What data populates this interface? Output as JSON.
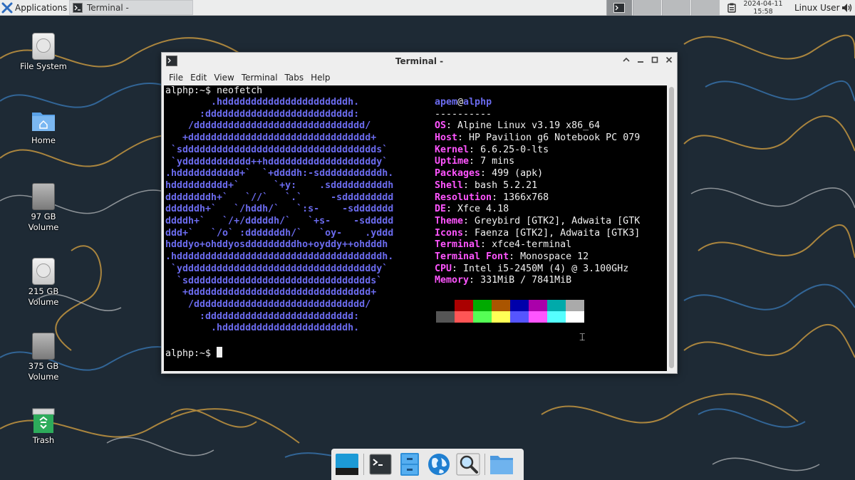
{
  "top_panel": {
    "applications_label": "Applications",
    "taskbar_item_label": "Terminal -",
    "clock_date": "2024-04-11",
    "clock_time": "15:58",
    "user_label": "Linux User"
  },
  "desktop_icons": [
    {
      "label": "File System",
      "icon": "drive-icon"
    },
    {
      "label": "Home",
      "icon": "home-folder-icon"
    },
    {
      "label": "97 GB Volume",
      "icon": "volume-icon"
    },
    {
      "label": "215 GB Volume",
      "icon": "drive-icon"
    },
    {
      "label": "375 GB Volume",
      "icon": "volume-icon"
    },
    {
      "label": "Trash",
      "icon": "trash-icon"
    }
  ],
  "window": {
    "title": "Terminal -",
    "menu": [
      "File",
      "Edit",
      "View",
      "Terminal",
      "Tabs",
      "Help"
    ]
  },
  "terminal": {
    "command_line": "alphp:~$ neofetch",
    "prompt": "alphp:~$ ",
    "logo_lines": [
      "        .hddddddddddddddddddddddh.",
      "      :dddddddddddddddddddddddddd:",
      "    /dddddddddddddddddddddddddddddd/",
      "   +dddddddddddddddddddddddddddddddd+",
      " `sdddddddddddddddddddddddddddddddddds`",
      " `ydddddddddddd++hdddddddddddddddddddy`",
      ".hddddddddddd+`  `+ddddh:-sdddddddddddh.",
      "hdddddddddd+`      `+y:    .sddddddddddh",
      "ddddddddh+`   `//`   `.`     -sddddddddd",
      "ddddddh+`   `/hddh/`   `:s-    -sddddddd",
      "ddddh+`   `/+/dddddh/`   `+s-    -sddddd",
      "ddd+`   `/o` :dddddddh/`   `oy-    .yddd",
      "hdddyo+ohddyosdddddddddho+oyddy++ohdddh",
      ".hddddddddddddddddddddddddddddddddddddh.",
      " `yddddddddddddddddddddddddddddddddddy`",
      "  `sdddddddddddddddddddddddddddddddds`",
      "   +dddddddddddddddddddddddddddddddd+",
      "    /dddddddddddddddddddddddddddddd/",
      "      :dddddddddddddddddddddddddd:",
      "        .hddddddddddddddddddddddh."
    ],
    "user": "apem",
    "host": "alphp",
    "separator": "----------",
    "info": [
      {
        "key": "OS",
        "value": "Alpine Linux v3.19 x86_64"
      },
      {
        "key": "Host",
        "value": "HP Pavilion g6 Notebook PC 079"
      },
      {
        "key": "Kernel",
        "value": "6.6.25-0-lts"
      },
      {
        "key": "Uptime",
        "value": "7 mins"
      },
      {
        "key": "Packages",
        "value": "499 (apk)"
      },
      {
        "key": "Shell",
        "value": "bash 5.2.21"
      },
      {
        "key": "Resolution",
        "value": "1366x768"
      },
      {
        "key": "DE",
        "value": "Xfce 4.18"
      },
      {
        "key": "Theme",
        "value": "Greybird [GTK2], Adwaita [GTK"
      },
      {
        "key": "Icons",
        "value": "Faenza [GTK2], Adwaita [GTK3]"
      },
      {
        "key": "Terminal",
        "value": "xfce4-terminal"
      },
      {
        "key": "Terminal Font",
        "value": "Monospace 12"
      },
      {
        "key": "CPU",
        "value": "Intel i5-2450M (4) @ 3.100GHz"
      },
      {
        "key": "Memory",
        "value": "331MiB / 7841MiB"
      }
    ],
    "palette_row1": [
      "#000000",
      "#aa0000",
      "#00aa00",
      "#aa5500",
      "#0000aa",
      "#aa00aa",
      "#00aaaa",
      "#aaaaaa"
    ],
    "palette_row2": [
      "#555555",
      "#ff5555",
      "#55ff55",
      "#ffff55",
      "#5555ff",
      "#ff55ff",
      "#55ffff",
      "#ffffff"
    ]
  },
  "dock": [
    "show-desktop-icon",
    "terminal-icon",
    "file-manager-icon",
    "web-browser-icon",
    "app-finder-icon",
    "folder-icon"
  ]
}
